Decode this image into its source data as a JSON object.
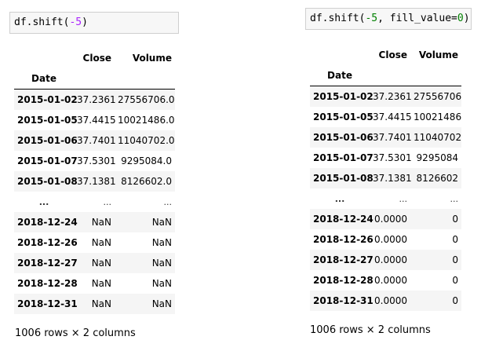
{
  "left": {
    "code_func": "df.shift(",
    "code_arg": "-5",
    "code_tail": "",
    "code_close": ")",
    "columns": [
      "Close",
      "Volume"
    ],
    "index_name": "Date",
    "rows": [
      {
        "date": "2015-01-02",
        "close": "37.2361",
        "volume": "27556706.0"
      },
      {
        "date": "2015-01-05",
        "close": "37.4415",
        "volume": "10021486.0"
      },
      {
        "date": "2015-01-06",
        "close": "37.7401",
        "volume": "11040702.0"
      },
      {
        "date": "2015-01-07",
        "close": "37.5301",
        "volume": "9295084.0"
      },
      {
        "date": "2015-01-08",
        "close": "37.1381",
        "volume": "8126602.0"
      },
      {
        "date": "...",
        "close": "...",
        "volume": "..."
      },
      {
        "date": "2018-12-24",
        "close": "NaN",
        "volume": "NaN"
      },
      {
        "date": "2018-12-26",
        "close": "NaN",
        "volume": "NaN"
      },
      {
        "date": "2018-12-27",
        "close": "NaN",
        "volume": "NaN"
      },
      {
        "date": "2018-12-28",
        "close": "NaN",
        "volume": "NaN"
      },
      {
        "date": "2018-12-31",
        "close": "NaN",
        "volume": "NaN"
      }
    ],
    "row_count": "1006 rows × 2 columns"
  },
  "right": {
    "code_func": "df.shift(",
    "code_arg": "-5",
    "code_tail": ", fill_value=",
    "code_val": "0",
    "code_close": ")",
    "columns": [
      "Close",
      "Volume"
    ],
    "index_name": "Date",
    "rows": [
      {
        "date": "2015-01-02",
        "close": "37.2361",
        "volume": "27556706"
      },
      {
        "date": "2015-01-05",
        "close": "37.4415",
        "volume": "10021486"
      },
      {
        "date": "2015-01-06",
        "close": "37.7401",
        "volume": "11040702"
      },
      {
        "date": "2015-01-07",
        "close": "37.5301",
        "volume": "9295084"
      },
      {
        "date": "2015-01-08",
        "close": "37.1381",
        "volume": "8126602"
      },
      {
        "date": "...",
        "close": "...",
        "volume": "..."
      },
      {
        "date": "2018-12-24",
        "close": "0.0000",
        "volume": "0"
      },
      {
        "date": "2018-12-26",
        "close": "0.0000",
        "volume": "0"
      },
      {
        "date": "2018-12-27",
        "close": "0.0000",
        "volume": "0"
      },
      {
        "date": "2018-12-28",
        "close": "0.0000",
        "volume": "0"
      },
      {
        "date": "2018-12-31",
        "close": "0.0000",
        "volume": "0"
      }
    ],
    "row_count": "1006 rows × 2 columns"
  },
  "colors": {
    "number": "#008000",
    "operator": "#aa22ff",
    "stripe": "#f5f5f5",
    "input_bg": "#f7f7f7"
  }
}
